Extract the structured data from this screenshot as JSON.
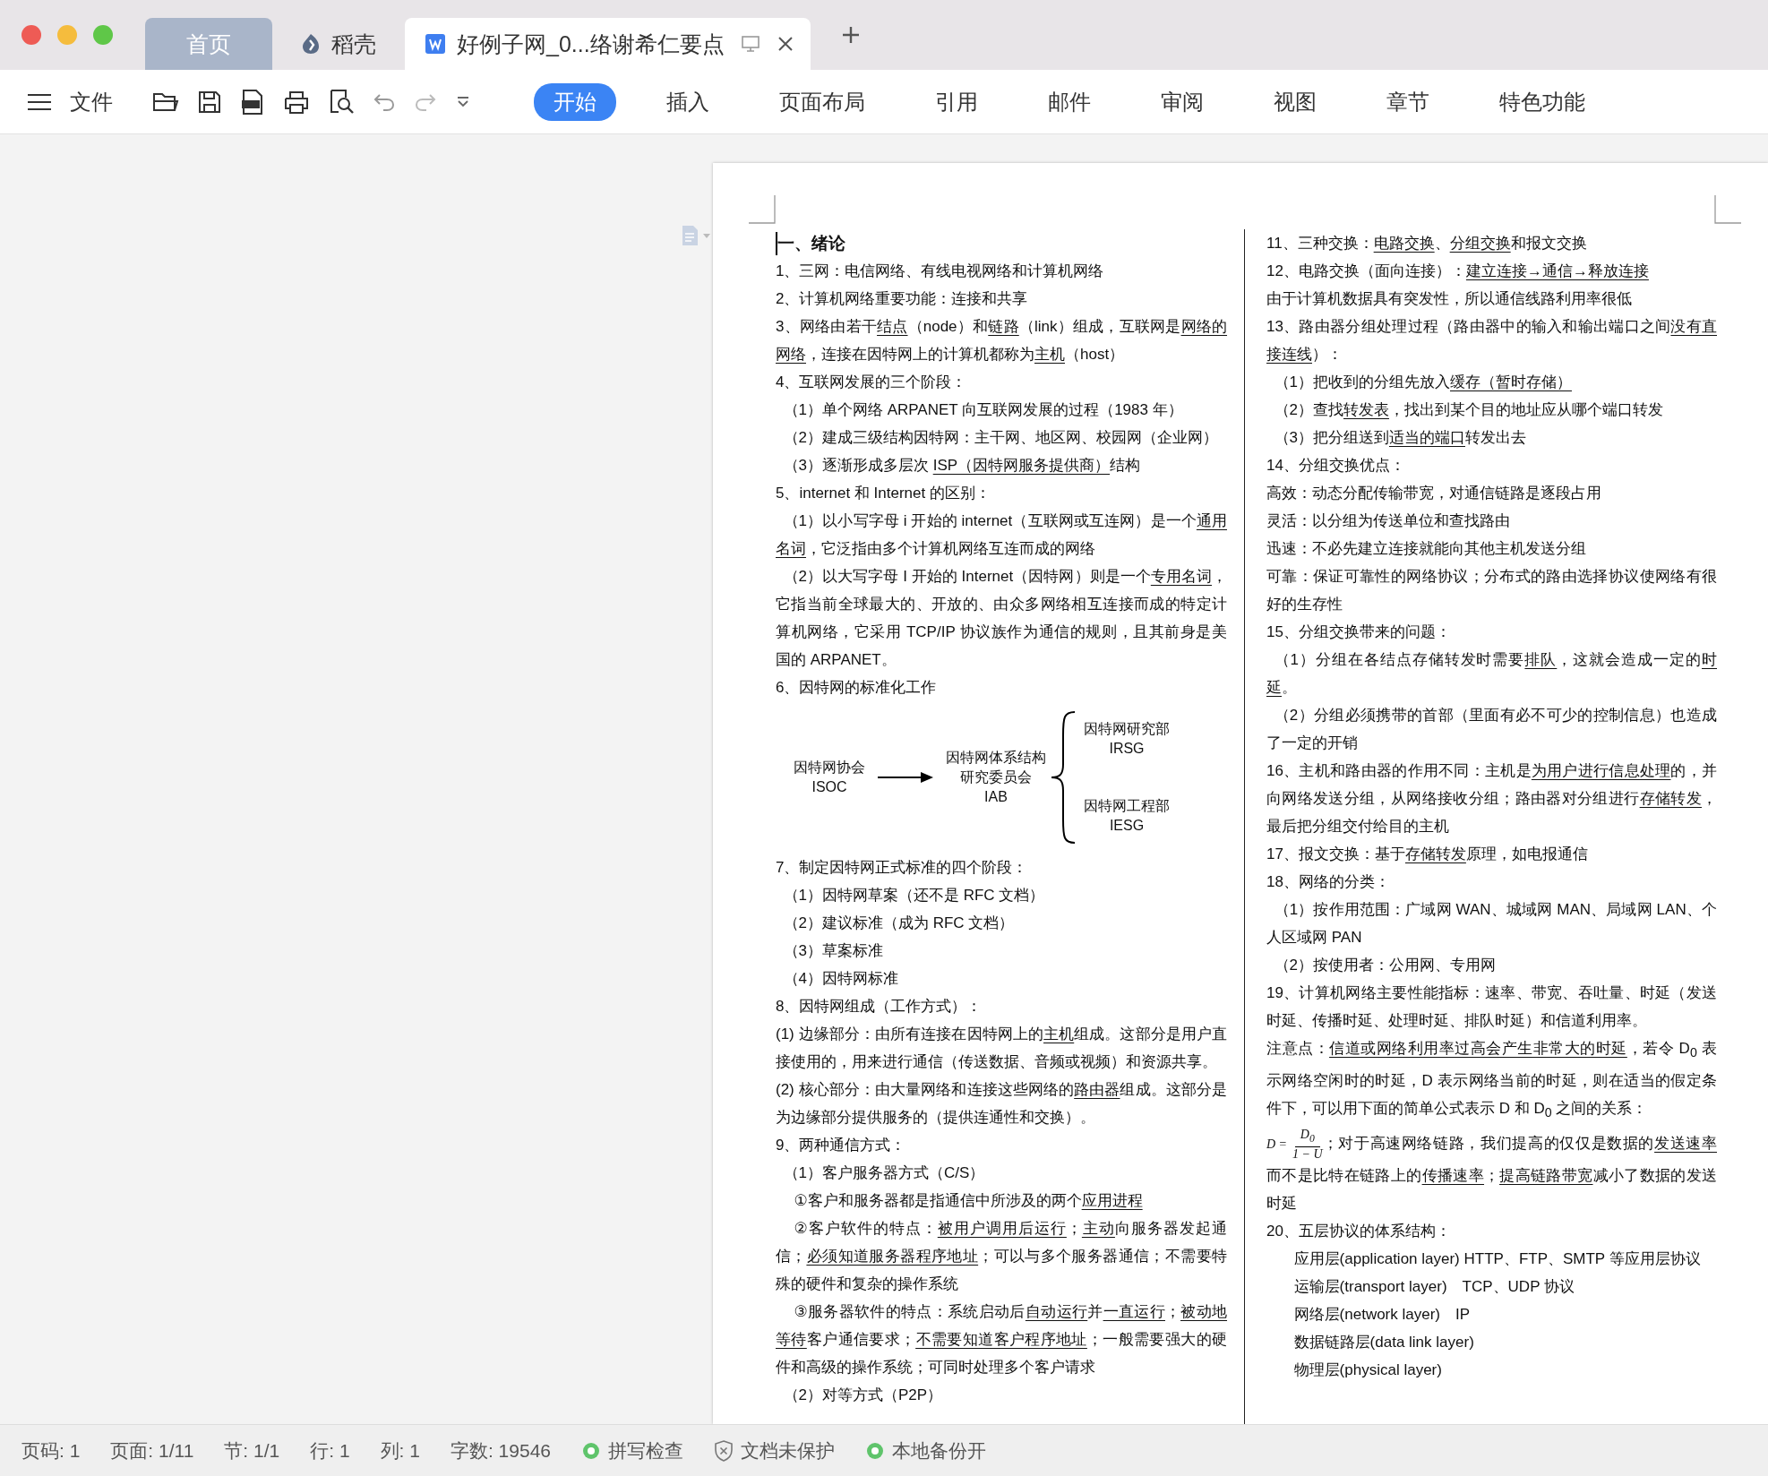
{
  "tabs": [
    {
      "kind": "home",
      "label": "首页",
      "selected": false
    },
    {
      "kind": "app",
      "label": "稻壳",
      "selected": false
    },
    {
      "kind": "doc",
      "label": "好例子网_0...络谢希仁要点",
      "selected": true
    }
  ],
  "toolbar": {
    "file_label": "文件"
  },
  "ribbon_tabs": [
    {
      "label": "开始",
      "selected": true
    },
    {
      "label": "插入",
      "selected": false
    },
    {
      "label": "页面布局",
      "selected": false
    },
    {
      "label": "引用",
      "selected": false
    },
    {
      "label": "邮件",
      "selected": false
    },
    {
      "label": "审阅",
      "selected": false
    },
    {
      "label": "视图",
      "selected": false
    },
    {
      "label": "章节",
      "selected": false
    },
    {
      "label": "特色功能",
      "selected": false
    }
  ],
  "document": {
    "left_column": [
      {
        "kind": "heading",
        "parts": [
          "一、绪论"
        ]
      },
      {
        "kind": "para",
        "parts": [
          "1、三网：电信网络、有线电视网络和计算机网络"
        ]
      },
      {
        "kind": "para",
        "parts": [
          "2、计算机网络重要功能：连接和共享"
        ]
      },
      {
        "kind": "para",
        "parts": [
          "3、网络由若干",
          {
            "underline": "结点"
          },
          "（node）和",
          {
            "underline": "链路"
          },
          "（link）组成，互联网是",
          {
            "underline": "网络的网络"
          },
          "，连接在因特网上的计算机都称为",
          {
            "underline": "主机"
          },
          "（host）"
        ]
      },
      {
        "kind": "para",
        "parts": [
          "4、互联网发展的三个阶段："
        ]
      },
      {
        "kind": "item",
        "parts": [
          "（1）单个网络 ARPANET 向互联网发展的过程（1983 年）"
        ]
      },
      {
        "kind": "item",
        "parts": [
          "（2）建成三级结构因特网：主干网、地区网、校园网（企业网）"
        ]
      },
      {
        "kind": "item",
        "parts": [
          "（3）逐渐形成多层次 ",
          {
            "underline": "ISP（因特网服务提供商）"
          },
          "结构"
        ]
      },
      {
        "kind": "para",
        "parts": [
          "5、internet 和 Internet 的区别："
        ]
      },
      {
        "kind": "item",
        "parts": [
          "（1）以小写字母 i 开始的 internet（互联网或互连网）是一个",
          {
            "underline": "通用名词"
          },
          "，它泛指由多个计算机网络互连而成的网络"
        ]
      },
      {
        "kind": "item",
        "parts": [
          "（2）以大写字母 I 开始的 Internet（因特网）则是一个",
          {
            "underline": "专用名词"
          },
          "，它指当前全球最大的、开放的、由众多网络相互连接而成的特定计算机网络，它采用 TCP/IP 协议族作为通信的规则，且其前身是美国的 ARPANET。"
        ]
      },
      {
        "kind": "para",
        "parts": [
          "6、因特网的标准化工作"
        ]
      },
      {
        "kind": "diagram",
        "source": [
          "因特网协会",
          "ISOC"
        ],
        "center": [
          "因特网体系结构",
          "研究委员会",
          "IAB"
        ],
        "branches": [
          [
            "因特网研究部",
            "IRSG"
          ],
          [
            "因特网工程部",
            "IESG"
          ]
        ]
      },
      {
        "kind": "para",
        "parts": [
          "7、制定因特网正式标准的四个阶段："
        ]
      },
      {
        "kind": "item",
        "parts": [
          "（1）因特网草案（还不是 RFC 文档）"
        ]
      },
      {
        "kind": "item",
        "parts": [
          "（2）建议标准（成为 RFC 文档）"
        ]
      },
      {
        "kind": "item",
        "parts": [
          "（3）草案标准"
        ]
      },
      {
        "kind": "item",
        "parts": [
          "（4）因特网标准"
        ]
      },
      {
        "kind": "para",
        "parts": [
          "8、因特网组成（工作方式）："
        ]
      },
      {
        "kind": "para",
        "parts": [
          "(1) 边缘部分：由所有连接在因特网上的",
          {
            "underline": "主机"
          },
          "组成。这部分是用户直接使用的，用来进行通信（传送数据、音频或视频）和资源共享。"
        ]
      },
      {
        "kind": "para",
        "parts": [
          "(2) 核心部分：由大量网络和连接这些网络的",
          {
            "underline": "路由器"
          },
          "组成。这部分是为边缘部分提供服务的（提供连通性和交换）。"
        ]
      },
      {
        "kind": "para",
        "parts": [
          "9、两种通信方式："
        ]
      },
      {
        "kind": "item",
        "parts": [
          "（1）客户服务器方式（C/S）"
        ]
      },
      {
        "kind": "sub",
        "parts": [
          "①客户和服务器都是指通信中所涉及的两个",
          {
            "underline": "应用进程"
          }
        ]
      },
      {
        "kind": "sub",
        "parts": [
          "②客户软件的特点：",
          {
            "underline": "被用户调用后运行"
          },
          "；",
          {
            "underline": "主动"
          },
          "向服务器发起通信；",
          {
            "underline": "必须知道服务器程序地址"
          },
          "；可以与多个服务器通信；不需要特殊的硬件和复杂的操作系统"
        ]
      },
      {
        "kind": "sub",
        "parts": [
          "③服务器软件的特点：系统启动后",
          {
            "underline": "自动运行"
          },
          "并",
          {
            "underline": "一直运行"
          },
          "；",
          {
            "underline": "被动地等待"
          },
          "客户通信要求；",
          {
            "underline": "不需要知道客户程序地址"
          },
          "；一般需要强大的硬件和高级的操作系统；可同时处理多个客户请求"
        ]
      },
      {
        "kind": "item",
        "parts": [
          "（2）对等方式（P2P）"
        ]
      }
    ],
    "right_column": [
      {
        "kind": "para",
        "parts": [
          "11、三种交换：",
          {
            "underline": "电路交换"
          },
          "、",
          {
            "underline": "分组交换"
          },
          "和报文交换"
        ]
      },
      {
        "kind": "para",
        "parts": [
          "12、电路交换（面向连接）：",
          {
            "underline": "建立连接→通信→释放连接"
          }
        ]
      },
      {
        "kind": "para",
        "parts": [
          "由于计算机数据具有突发性，所以通信线路利用率很低"
        ]
      },
      {
        "kind": "para",
        "parts": [
          "13、路由器分组处理过程（路由器中的输入和输出端口之间",
          {
            "underline": "没有直接连线"
          },
          "）："
        ]
      },
      {
        "kind": "item",
        "parts": [
          "（1）把收到的分组先放入",
          {
            "underline": "缓存（暂时存储）"
          }
        ]
      },
      {
        "kind": "item",
        "parts": [
          "（2）查找",
          {
            "underline": "转发表"
          },
          "，找出到某个目的地址应从哪个端口转发"
        ]
      },
      {
        "kind": "item",
        "parts": [
          "（3）把分组送到",
          {
            "underline": "适当的端口"
          },
          "转发出去"
        ]
      },
      {
        "kind": "para",
        "parts": [
          "14、分组交换优点："
        ]
      },
      {
        "kind": "para",
        "parts": [
          "高效：动态分配传输带宽，对通信链路是逐段占用"
        ]
      },
      {
        "kind": "para",
        "parts": [
          "灵活：以分组为传送单位和查找路由"
        ]
      },
      {
        "kind": "para",
        "parts": [
          "迅速：不必先建立连接就能向其他主机发送分组"
        ]
      },
      {
        "kind": "para",
        "parts": [
          "可靠：保证可靠性的网络协议；分布式的路由选择协议使网络有很好的生存性"
        ]
      },
      {
        "kind": "para",
        "parts": [
          "15、分组交换带来的问题："
        ]
      },
      {
        "kind": "item",
        "parts": [
          "（1）分组在各结点存储转发时需要",
          {
            "underline": "排队"
          },
          "，这就会造成一定的",
          {
            "underline": "时延"
          },
          "。"
        ]
      },
      {
        "kind": "item",
        "parts": [
          "（2）分组必须携带的首部（里面有必不可少的控制信息）也造成了一定的开销"
        ]
      },
      {
        "kind": "para",
        "parts": [
          "16、主机和路由器的作用不同：主机是",
          {
            "underline": "为用户进行信息处理"
          },
          "的，并向网络发送分组，从网络接收分组；路由器对分组进行",
          {
            "underline": "存储转发"
          },
          "，最后把分组交付给目的主机"
        ]
      },
      {
        "kind": "para",
        "parts": [
          "17、报文交换：基于",
          {
            "underline": "存储转发"
          },
          "原理，如电报通信"
        ]
      },
      {
        "kind": "para",
        "parts": [
          "18、网络的分类："
        ]
      },
      {
        "kind": "item",
        "parts": [
          "（1）按作用范围：广域网 WAN、城域网 MAN、局域网 LAN、个人区域网 PAN"
        ]
      },
      {
        "kind": "item",
        "parts": [
          "（2）按使用者：公用网、专用网"
        ]
      },
      {
        "kind": "para",
        "parts": [
          "19、计算机网络主要性能指标：速率、带宽、吞吐量、时延（发送时延、传播时延、处理时延、排队时延）和信道利用率。"
        ]
      },
      {
        "kind": "para",
        "parts": [
          "注意点：",
          {
            "underline": "信道或网络利用率过高会产生非常大的时延"
          },
          "，若令 D$_{0}$ 表示网络空闲时的时延，D 表示网络当前的时延，则在适当的假定条件下，可以用下面的简单公式表示 D 和 D$_{0}$ 之间的关系："
        ]
      },
      {
        "kind": "formula",
        "formula": {
          "lhs": "D =",
          "numerator": "D$_{0}$",
          "denominator": "1 − U"
        },
        "parts": [
          "；对于高速网络链路，我们提高的仅仅是数据的",
          {
            "underline": "发送速率"
          },
          "而不是比特在链路上的",
          {
            "underline": "传播速率"
          },
          "；",
          {
            "underline": "提高链路带宽"
          },
          "减小了数据的发送时延"
        ]
      },
      {
        "kind": "para",
        "parts": [
          "20、五层协议的体系结构："
        ]
      },
      {
        "kind": "layer",
        "parts": [
          "应用层(application layer) HTTP、FTP、SMTP 等应用层协议"
        ]
      },
      {
        "kind": "layer",
        "parts": [
          "运输层(transport layer)　TCP、UDP 协议"
        ]
      },
      {
        "kind": "layer",
        "parts": [
          "网络层(network layer)　IP"
        ]
      },
      {
        "kind": "layer",
        "parts": [
          "数据链路层(data link layer)"
        ]
      },
      {
        "kind": "layer",
        "parts": [
          "物理层(physical layer)"
        ]
      }
    ]
  },
  "status_bar": [
    {
      "kind": "text",
      "label": "页码: 1"
    },
    {
      "kind": "text",
      "label": "页面: 1/11"
    },
    {
      "kind": "text",
      "label": "节: 1/1"
    },
    {
      "kind": "text",
      "label": "行: 1"
    },
    {
      "kind": "text",
      "label": "列: 1"
    },
    {
      "kind": "text",
      "label": "字数: 19546"
    },
    {
      "kind": "check",
      "label": "拼写检查"
    },
    {
      "kind": "shield",
      "label": "文档未保护"
    },
    {
      "kind": "check",
      "label": "本地备份开"
    }
  ]
}
